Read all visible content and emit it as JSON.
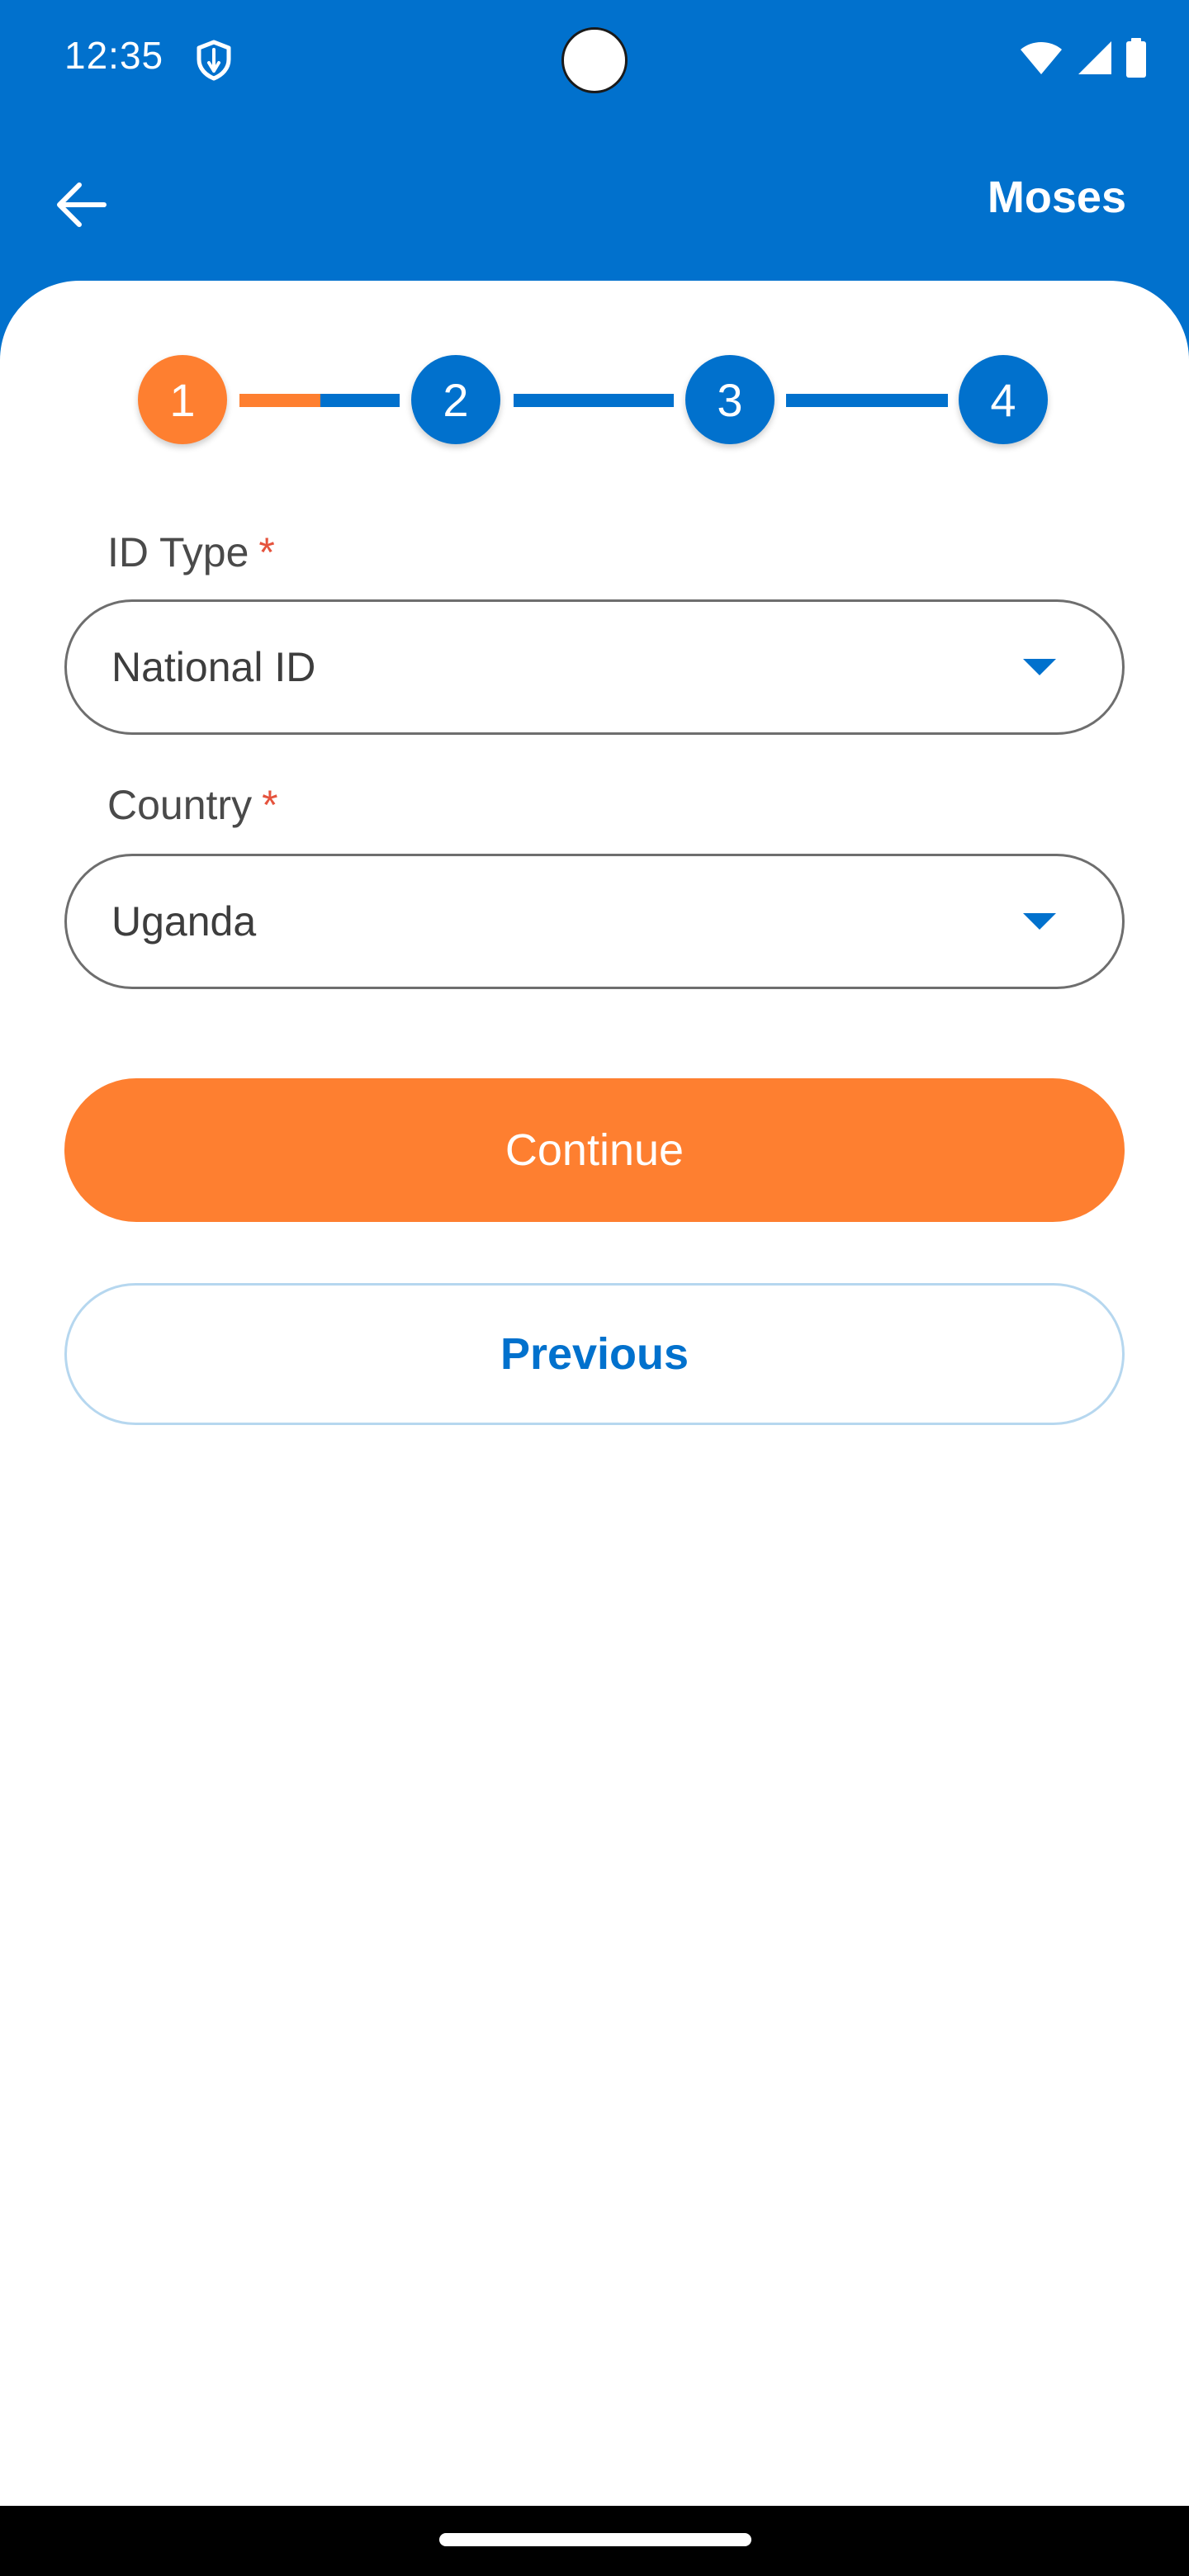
{
  "status_bar": {
    "time": "12:35",
    "icons": [
      "shield-icon",
      "wifi-icon",
      "signal-icon",
      "battery-icon"
    ]
  },
  "app_bar": {
    "back_icon": "arrow-left-icon",
    "user_name": "Moses"
  },
  "stepper": {
    "steps": [
      "1",
      "2",
      "3",
      "4"
    ],
    "current_step": 1,
    "active_color": "#fe7f30",
    "inactive_color": "#0171cd"
  },
  "form": {
    "id_type": {
      "label": "ID Type",
      "required_mark": "*",
      "value": "National ID"
    },
    "country": {
      "label": "Country",
      "required_mark": "*",
      "value": "Uganda"
    }
  },
  "buttons": {
    "continue_label": "Continue",
    "previous_label": "Previous"
  },
  "colors": {
    "primary": "#0171cd",
    "accent": "#fe7f30",
    "required": "#e5533d"
  }
}
